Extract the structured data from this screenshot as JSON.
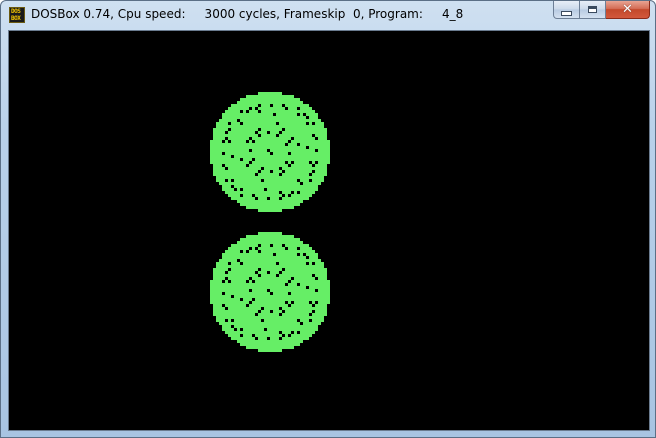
{
  "window": {
    "icon_line1": "DOS",
    "icon_line2": "BOX",
    "title": "DOSBox 0.74, Cpu speed:     3000 cycles, Frameskip  0, Program:     4_8"
  },
  "caption_buttons": {
    "minimize_glyph": "",
    "maximize_glyph": "",
    "close_glyph": "✕"
  },
  "screen": {
    "background_color": "#000000",
    "circle_color": "#66ee66",
    "dot_color": "#000000",
    "circles": [
      {
        "name": "upper-green-circle"
      },
      {
        "name": "lower-green-circle"
      }
    ]
  }
}
